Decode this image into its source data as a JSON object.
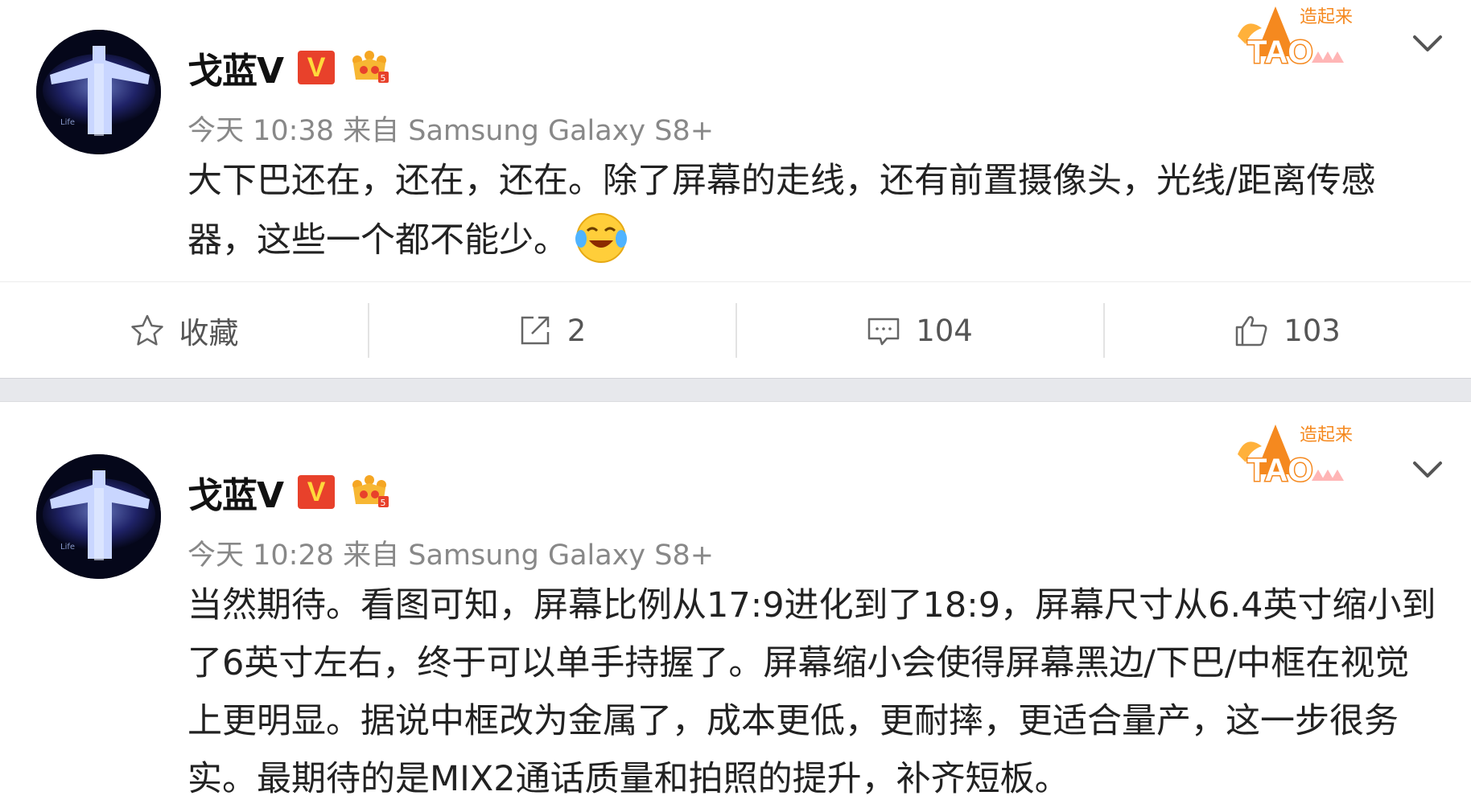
{
  "posts": [
    {
      "author": "戈蓝V",
      "verified_badge": "V",
      "timestamp": "今天 10:38 来自 Samsung Galaxy S8+",
      "content": "大下巴还在，还在，还在。除了屏幕的走线，还有前置摄像头，光线/距离传感器，这些一个都不能少。",
      "tag_icon": "tao-campaign-badge",
      "actions": {
        "favorite_label": "收藏",
        "repost_count": "2",
        "comment_count": "104",
        "like_count": "103"
      }
    },
    {
      "author": "戈蓝V",
      "verified_badge": "V",
      "timestamp": "今天 10:28 来自 Samsung Galaxy S8+",
      "content": "当然期待。看图可知，屏幕比例从17:9进化到了18:9，屏幕尺寸从6.4英寸缩小到了6英寸左右，终于可以单手持握了。屏幕缩小会使得屏幕黑边/下巴/中框在视觉上更明显。据说中框改为金属了，成本更低，更耐摔，更适合量产，这一步很务实。最期待的是MIX2通话质量和拍照的提升，补齐短板。",
      "tag_icon": "tao-campaign-badge"
    }
  ],
  "colors": {
    "verified_red": "#e8412b",
    "verified_yellow": "#ffd93b",
    "tag_orange": "#f5891f",
    "separator": "#e7e8ec"
  },
  "icons": [
    "avatar",
    "vip-crown-icon",
    "chevron-down-icon",
    "star-icon",
    "share-icon",
    "comment-icon",
    "thumbs-up-icon",
    "laughing-crying-emoji"
  ]
}
